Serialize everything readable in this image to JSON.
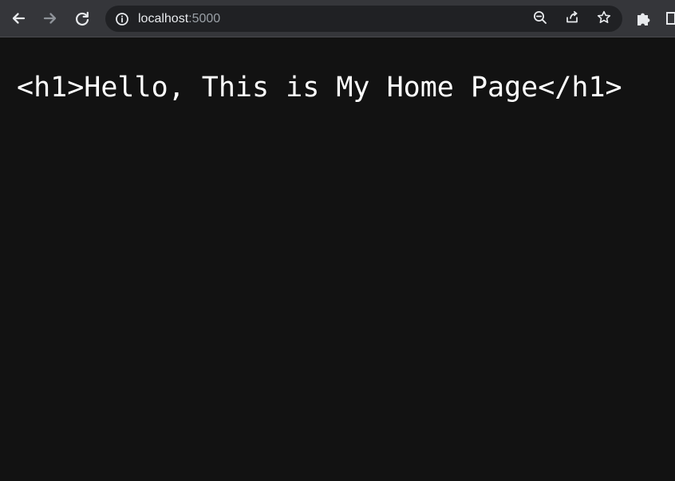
{
  "browser": {
    "url_host": "localhost",
    "url_port": ":5000",
    "icons": {
      "back": "back-arrow-icon",
      "forward": "forward-arrow-icon",
      "reload": "reload-icon",
      "info": "info-icon",
      "zoom": "zoom-out-icon",
      "share": "share-icon",
      "bookmark": "bookmark-star-icon",
      "extensions": "puzzle-piece-icon",
      "side_panel": "side-panel-icon"
    },
    "colors": {
      "toolbar": "#35363a",
      "omnibox": "#202124",
      "page_background": "#121212",
      "text": "#ffffff"
    }
  },
  "page": {
    "raw_text": "<h1>Hello, This is My Home Page</h1>"
  }
}
